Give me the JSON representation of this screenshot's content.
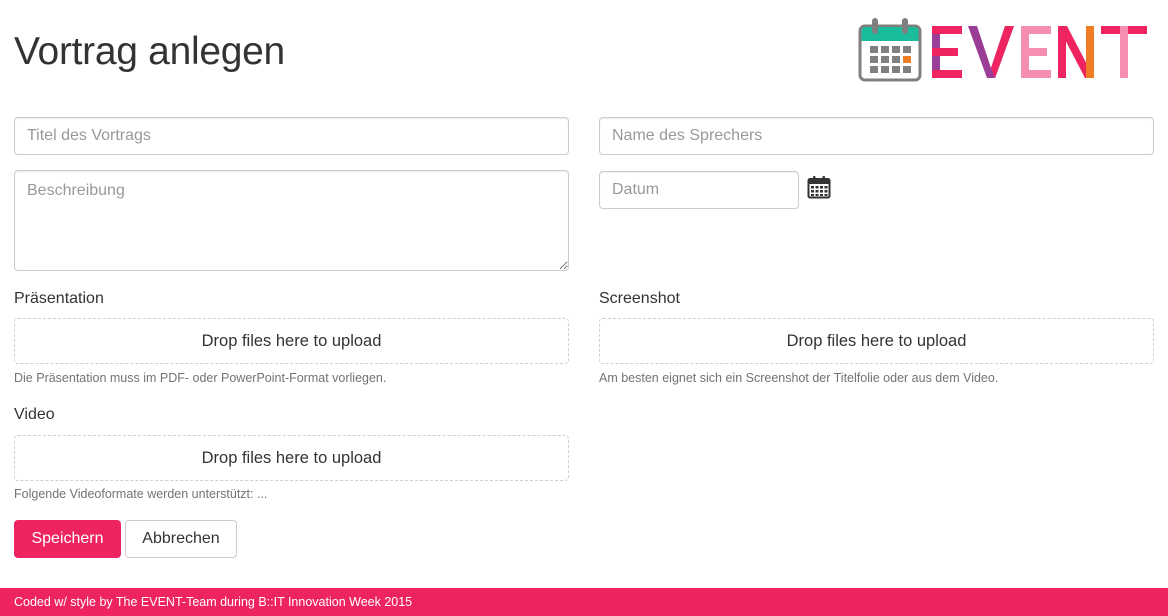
{
  "page": {
    "title": "Vortrag anlegen"
  },
  "logo": {
    "text": "EVENT",
    "letter_colors": [
      "#ee2461",
      "#9b3d97",
      "#f48fb1",
      "#ee2461",
      "#f48fb1"
    ],
    "calendar_header_color": "#1abc9c"
  },
  "form": {
    "title_input": {
      "placeholder": "Titel des Vortrags",
      "value": ""
    },
    "speaker_input": {
      "placeholder": "Name des Sprechers",
      "value": ""
    },
    "description_input": {
      "placeholder": "Beschreibung",
      "value": ""
    },
    "date_input": {
      "placeholder": "Datum",
      "value": ""
    },
    "presentation": {
      "label": "Präsentation",
      "dropzone_text": "Drop files here to upload",
      "help": "Die Präsentation muss im PDF- oder PowerPoint-Format vorliegen."
    },
    "screenshot": {
      "label": "Screenshot",
      "dropzone_text": "Drop files here to upload",
      "help": "Am besten eignet sich ein Screenshot der Titelfolie oder aus dem Video."
    },
    "video": {
      "label": "Video",
      "dropzone_text": "Drop files here to upload",
      "help": "Folgende Videoformate werden unterstützt: ..."
    },
    "save_label": "Speichern",
    "cancel_label": "Abbrechen"
  },
  "footer": {
    "text": "Coded w/ style by The EVENT-Team during B::IT Innovation Week 2015"
  },
  "colors": {
    "accent": "#ee2461",
    "input_border": "#cccccc",
    "placeholder": "#999999",
    "help_text": "#737373"
  },
  "icons": {
    "date_picker": "calendar-icon"
  }
}
